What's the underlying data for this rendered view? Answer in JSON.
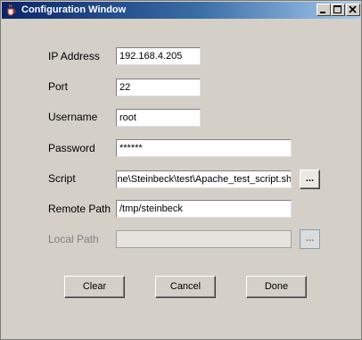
{
  "window": {
    "title": "Configuration Window",
    "controls": {
      "minimize_icon": "minimize-icon",
      "maximize_icon": "maximize-icon",
      "close_icon": "close-icon"
    },
    "title_icon": "java-cup-icon"
  },
  "form": {
    "ip_address": {
      "label": "IP Address",
      "value": "192.168.4.205"
    },
    "port": {
      "label": "Port",
      "value": "22"
    },
    "username": {
      "label": "Username",
      "value": "root"
    },
    "password": {
      "label": "Password",
      "value": "******"
    },
    "script": {
      "label": "Script",
      "value": "ine\\Steinbeck\\test\\Apache_test_script.sh",
      "browse_label": "..."
    },
    "remote_path": {
      "label": "Remote Path",
      "value": "/tmp/steinbeck"
    },
    "local_path": {
      "label": "Local Path",
      "value": "",
      "browse_label": "...",
      "enabled": false
    }
  },
  "buttons": {
    "clear": "Clear",
    "cancel": "Cancel",
    "done": "Done"
  },
  "colors": {
    "title_start": "#0a246a",
    "title_end": "#a6caf0",
    "dialog_bg": "#d4d0c8"
  }
}
